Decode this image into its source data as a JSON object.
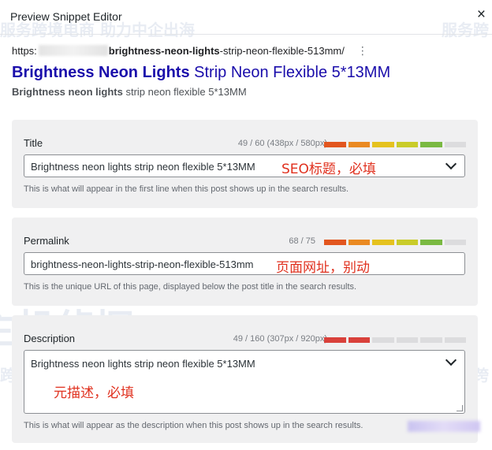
{
  "dialog": {
    "title": "Preview Snippet Editor",
    "close_glyph": "×"
  },
  "watermark": {
    "logo_text": "主机侦探",
    "slogan": "服务跨境电商 助力中企出海",
    "slogan_short": "服务跨"
  },
  "preview": {
    "url_prefix": "https:",
    "url_bold": "brightness-neon-lights",
    "url_rest": "-strip-neon-flexible-513mm/",
    "menu_glyph": "⋮",
    "title_bold": "Brightness Neon Lights",
    "title_rest": " Strip Neon Flexible 5*13MM",
    "desc_bold": "Brightness neon lights",
    "desc_rest": " strip neon flexible 5*13MM"
  },
  "title_section": {
    "label": "Title",
    "count": "49 / 60 (438px / 580px)",
    "value": "Brightness neon lights strip neon flexible 5*13MM",
    "hint": "This is what will appear in the first line when this post shows up in the search results.",
    "annotation": "SEO标题，必填",
    "segments": [
      "#e2561f",
      "#ea8a22",
      "#e5c21f",
      "#c9cc2a",
      "#7ab942",
      "#dcdcde"
    ],
    "progress": 0.82
  },
  "permalink_section": {
    "label": "Permalink",
    "count": "68 / 75",
    "value": "brightness-neon-lights-strip-neon-flexible-513mm",
    "hint": "This is the unique URL of this page, displayed below the post title in the search results.",
    "annotation": "页面网址，别动",
    "segments": [
      "#e2561f",
      "#ea8a22",
      "#e5c21f",
      "#c9cc2a",
      "#7ab942",
      "#dcdcde"
    ],
    "progress": 0.91
  },
  "description_section": {
    "label": "Description",
    "count": "49 / 160 (307px / 920px)",
    "value": "Brightness neon lights strip neon flexible 5*13MM",
    "hint": "This is what will appear as the description when this post shows up in the search results.",
    "annotation": "元描述，必填",
    "segments": [
      "#d9413b",
      "#d9413b",
      "#dcdcde",
      "#dcdcde",
      "#dcdcde",
      "#dcdcde"
    ],
    "progress": 0.31
  }
}
